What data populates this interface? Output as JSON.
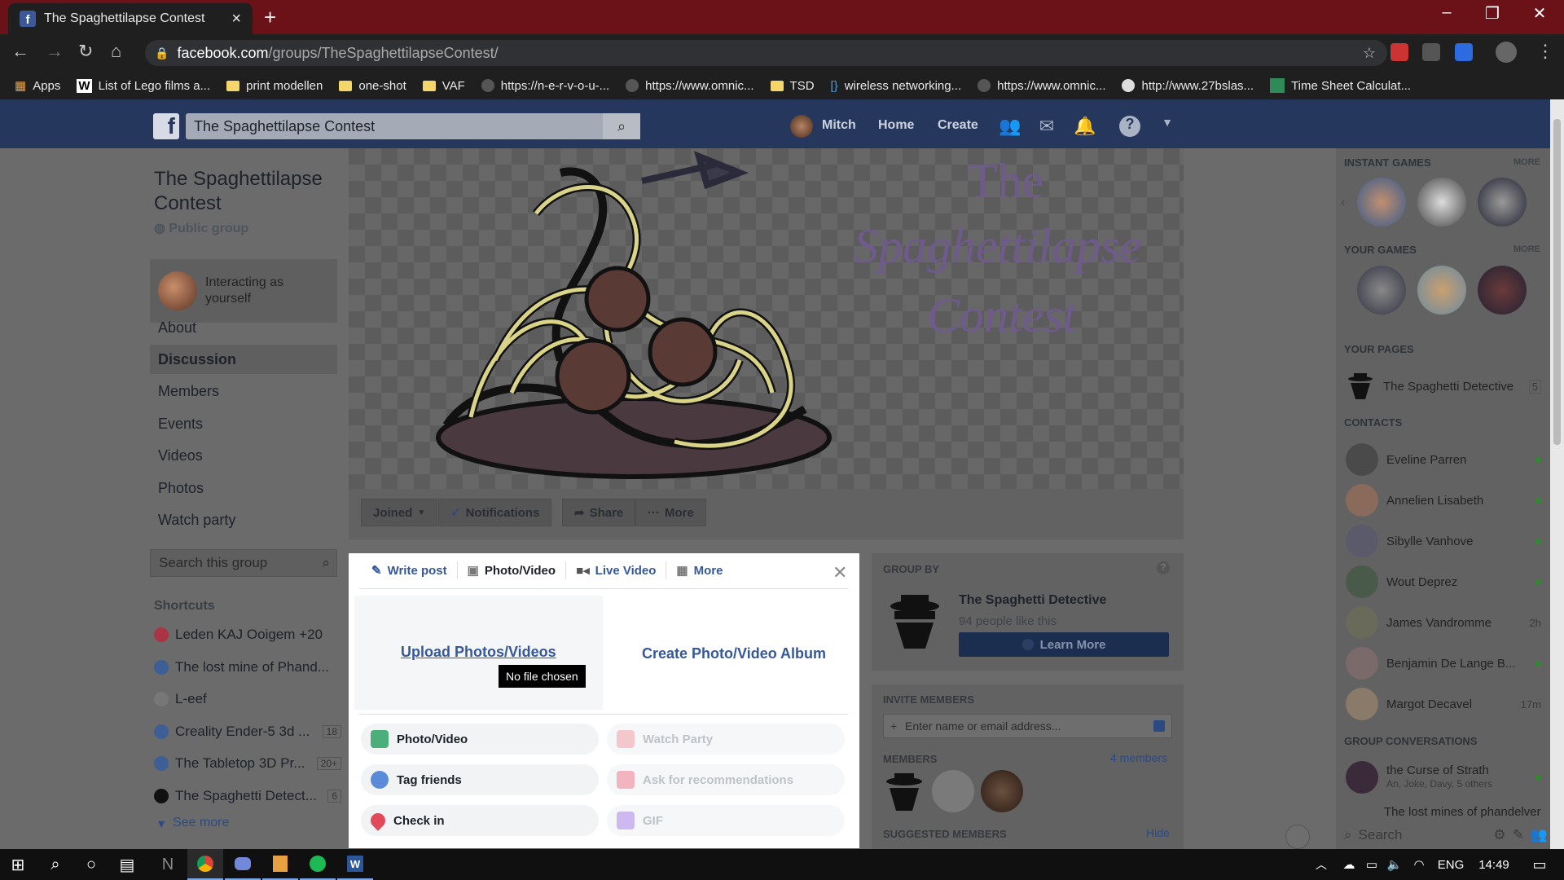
{
  "browser": {
    "tab_title": "The Spaghettilapse Contest",
    "url_host": "facebook.com",
    "url_path": "/groups/TheSpaghettilapseContest/",
    "bookmarks": [
      "Apps",
      "List of Lego films a...",
      "print modellen",
      "one-shot",
      "VAF",
      "https://n-e-r-v-o-u-...",
      "https://www.omnic...",
      "TSD",
      "wireless networking...",
      "https://www.omnic...",
      "http://www.27bslas...",
      "Time Sheet Calculat..."
    ]
  },
  "fb_header": {
    "search_value": "The Spaghettilapse Contest",
    "user": "Mitch",
    "home": "Home",
    "create": "Create"
  },
  "group": {
    "name": "The Spaghettilapse Contest",
    "privacy": "Public group",
    "interacting": "Interacting as yourself",
    "nav": [
      "About",
      "Discussion",
      "Members",
      "Events",
      "Videos",
      "Photos",
      "Watch party"
    ],
    "search_placeholder": "Search this group",
    "shortcuts_title": "Shortcuts",
    "shortcuts": [
      {
        "label": "Leden KAJ Ooigem +20",
        "badge": ""
      },
      {
        "label": "The lost mine of Phand...",
        "badge": ""
      },
      {
        "label": "L-eef",
        "badge": ""
      },
      {
        "label": "Creality Ender-5 3d ...",
        "badge": "18"
      },
      {
        "label": "The Tabletop 3D Pr...",
        "badge": "20+"
      },
      {
        "label": "The Spaghetti Detect...",
        "badge": "6"
      }
    ],
    "see_more": "See more"
  },
  "cover": {
    "title_lines": [
      "The",
      "Spaghettilapse",
      "Contest"
    ]
  },
  "actions": {
    "joined": "Joined",
    "notifications": "Notifications",
    "share": "Share",
    "more": "More"
  },
  "composer": {
    "tabs": [
      "Write post",
      "Photo/Video",
      "Live Video",
      "More"
    ],
    "upload": "Upload Photos/Videos",
    "no_file": "No file chosen",
    "album": "Create Photo/Video Album",
    "options": [
      {
        "label": "Photo/Video",
        "dim": false
      },
      {
        "label": "Watch Party",
        "dim": true
      },
      {
        "label": "Tag friends",
        "dim": false
      },
      {
        "label": "Ask for recommendations",
        "dim": true
      },
      {
        "label": "Check in",
        "dim": false
      },
      {
        "label": "GIF",
        "dim": true
      }
    ]
  },
  "group_by": {
    "title": "GROUP BY",
    "page": "The Spaghetti Detective",
    "likes": "94 people like this",
    "learn_more": "Learn More"
  },
  "invite": {
    "title": "INVITE MEMBERS",
    "placeholder": "Enter name or email address...",
    "members_title": "MEMBERS",
    "members_count": "4 members",
    "suggested": "SUGGESTED MEMBERS",
    "hide": "Hide"
  },
  "right": {
    "instant_games": "INSTANT GAMES",
    "your_games": "YOUR GAMES",
    "more": "MORE",
    "your_pages": "YOUR PAGES",
    "page_name": "The Spaghetti Detective",
    "page_badge": "5",
    "contacts_title": "CONTACTS",
    "contacts": [
      {
        "name": "Eveline Parren",
        "status": ""
      },
      {
        "name": "Annelien Lisabeth",
        "status": ""
      },
      {
        "name": "Sibylle Vanhove",
        "status": ""
      },
      {
        "name": "Wout Deprez",
        "status": ""
      },
      {
        "name": "James Vandromme",
        "status": "2h"
      },
      {
        "name": "Benjamin De Lange B...",
        "status": ""
      },
      {
        "name": "Margot Decavel",
        "status": "17m"
      }
    ],
    "group_conv": "GROUP CONVERSATIONS",
    "conv1": "the Curse of Strath",
    "conv1_sub": "An, Joke, Davy, 5 others",
    "conv2": "The lost mines of phandelver",
    "chat_search": "Search"
  },
  "taskbar": {
    "lang": "ENG",
    "time": "14:49"
  }
}
